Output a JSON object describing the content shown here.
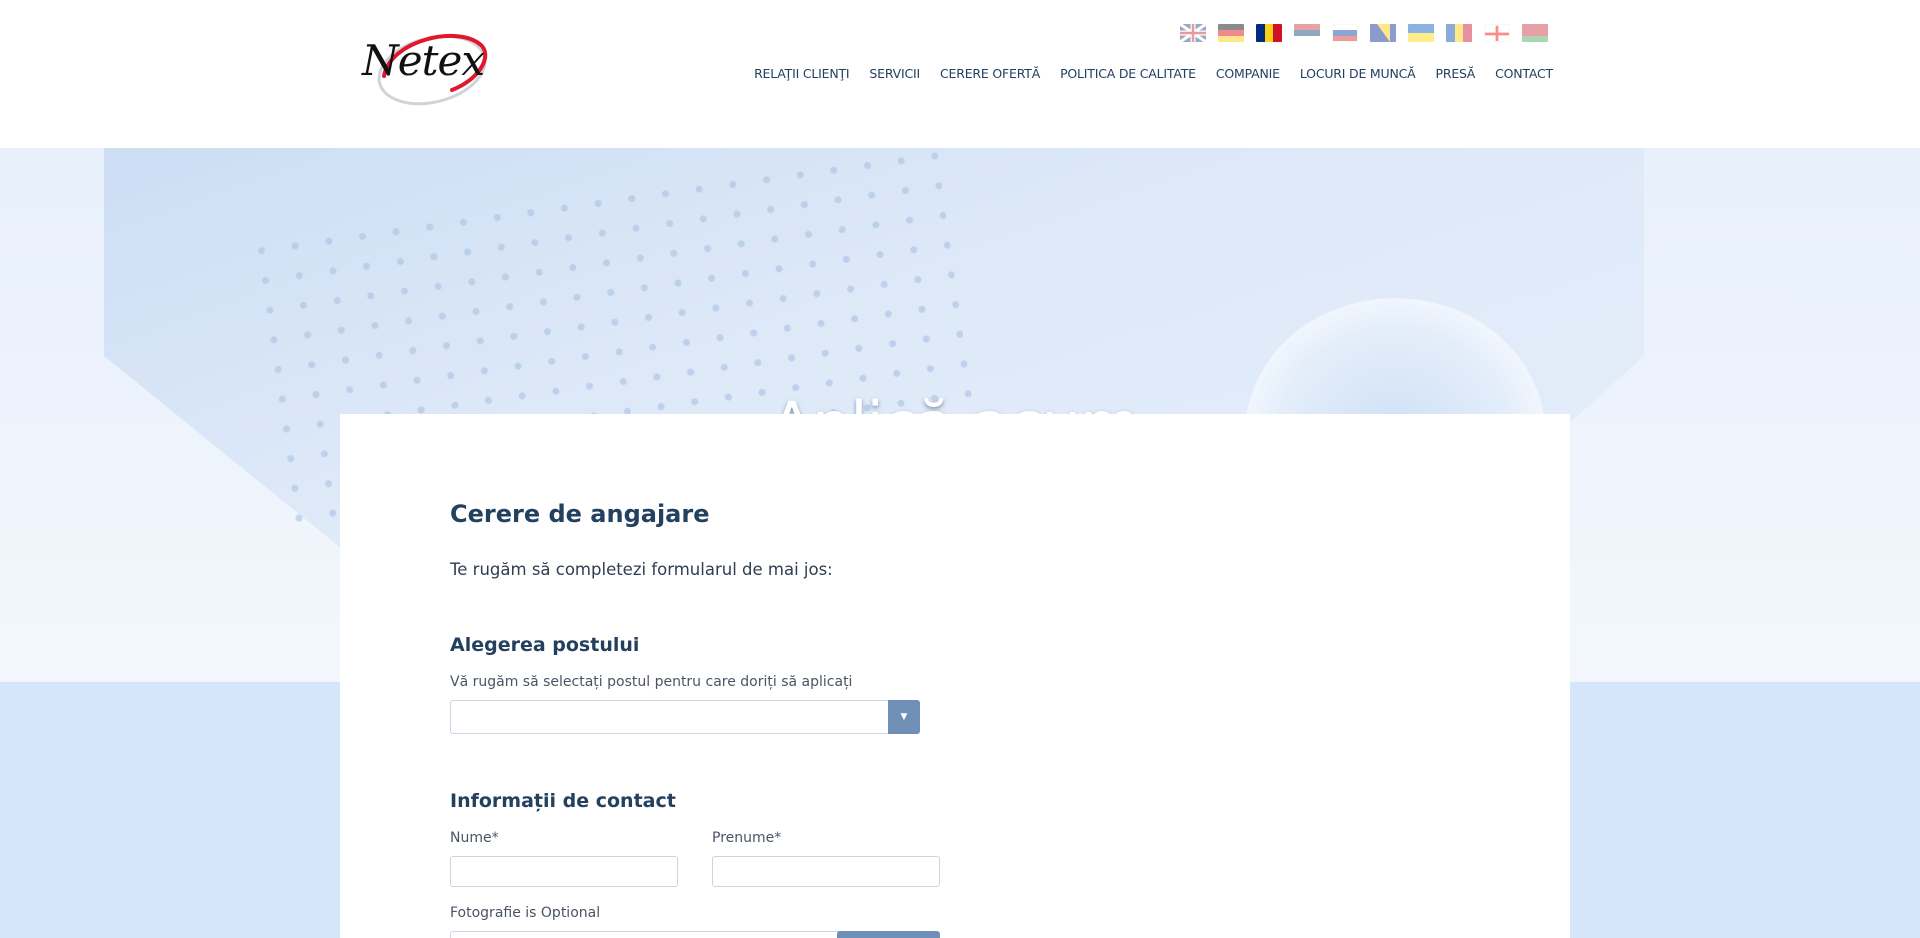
{
  "brand": {
    "logo_text": "Netex"
  },
  "languages": [
    {
      "name": "english-flag",
      "active": false
    },
    {
      "name": "german-flag",
      "active": false
    },
    {
      "name": "romanian-flag",
      "active": true
    },
    {
      "name": "serbian-flag",
      "active": false
    },
    {
      "name": "russian-flag",
      "active": false
    },
    {
      "name": "bosnian-flag",
      "active": false
    },
    {
      "name": "ukrainian-flag",
      "active": false
    },
    {
      "name": "moldovan-flag",
      "active": false
    },
    {
      "name": "georgian-flag",
      "active": false
    },
    {
      "name": "belarusian-flag",
      "active": false
    }
  ],
  "nav": {
    "items": [
      "Relaţii clienţi",
      "Servicii",
      "Cerere ofertă",
      "Politica de calitate",
      "Companie",
      "Locuri de muncă",
      "Presă",
      "Contact"
    ]
  },
  "hero": {
    "title": "Aplică acum"
  },
  "form": {
    "title": "Cerere de angajare",
    "intro": "Te rugăm să completezi formularul de mai jos:",
    "position_section": {
      "title": "Alegerea postului",
      "label": "Vă rugăm să selectați postul pentru care doriți să aplicați",
      "selected": ""
    },
    "contact_section": {
      "title": "Informații de contact",
      "last_name_label": "Nume*",
      "first_name_label": "Prenume*",
      "photo_label": "Fotografie is Optional"
    }
  },
  "colors": {
    "primary": "#23405f",
    "accent_button": "#6f8fb6",
    "background": "#d6e6fa"
  }
}
